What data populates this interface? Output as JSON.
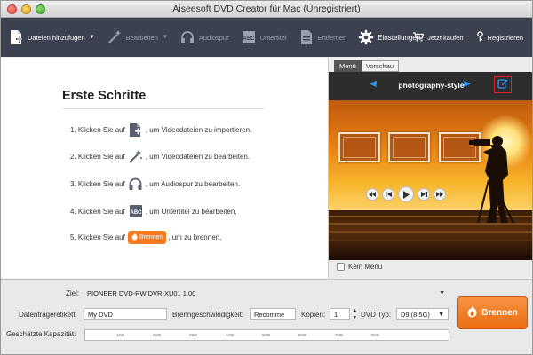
{
  "window": {
    "title": "Aiseesoft DVD Creator für Mac (Unregistriert)"
  },
  "toolbar": {
    "add_files": "Dateien hinzufügen",
    "edit": "Bearbeiten",
    "audio": "Audiospur",
    "subtitle": "Untertitel",
    "remove": "Entfernen",
    "settings": "Einstellungen",
    "buy": "Jetzt kaufen",
    "register": "Registrieren"
  },
  "getting_started": {
    "title": "Erste Schritte",
    "steps": [
      {
        "prefix": "1. Klicken Sie auf",
        "suffix": ", um Videodateien zu importieren."
      },
      {
        "prefix": "2. Klicken Sie auf",
        "suffix": ", um Videodateien zu bearbeiten."
      },
      {
        "prefix": "3. Klicken Sie auf",
        "suffix": ", um Audiospur zu bearbeiten."
      },
      {
        "prefix": "4. Klicken Sie auf",
        "suffix": ", um Untertitel zu bearbeiten."
      },
      {
        "prefix": "5. Klicken Sie auf",
        "chip": "Brennen",
        "suffix": ", um zu brennen."
      }
    ]
  },
  "menu_panel": {
    "tab_menu": "Menü",
    "tab_preview": "Vorschau",
    "style_name": "photography-style",
    "no_menu": "Kein Menü"
  },
  "bottom": {
    "target_label": "Ziel:",
    "target_value": "PIONEER DVD-RW DVR-XU01 1.00",
    "disc_label_label": "Datenträgeretikett:",
    "disc_label_value": "My DVD",
    "burn_speed_label": "Brenngeschwindigkeit:",
    "burn_speed_value": "Recomme",
    "copies_label": "Kopien:",
    "copies_value": "1",
    "dvd_type_label": "DVD Typ:",
    "dvd_type_value": "D9 (8.5G)",
    "capacity_label": "Geschätzte Kapazität:",
    "capacity_ticks": [
      "1GB",
      "2GB",
      "3GB",
      "4GB",
      "5GB",
      "6GB",
      "7GB",
      "8GB"
    ],
    "burn_button": "Brennen"
  },
  "colors": {
    "toolbar_bg": "#3c4150",
    "accent_orange": "#f47b20",
    "nav_blue": "#2f94ea",
    "highlight_red": "#e02222"
  }
}
